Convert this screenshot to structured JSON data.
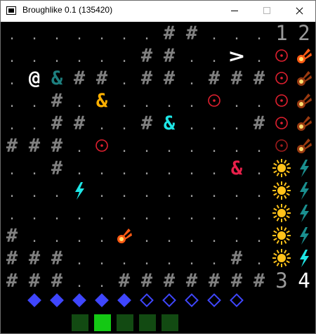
{
  "window": {
    "title": "Broughlike 0.1 (135420)",
    "icon": "console-window-icon",
    "controls": [
      "minimize-icon",
      "maximize-icon",
      "close-icon"
    ]
  },
  "colors": {
    "background": "#000000",
    "floor": "#9a9a9a",
    "wall": "#808080",
    "player": "#ffffff",
    "companion_teal": "#1d7f7f",
    "monster_orange": "#ffb000",
    "monster_cyan": "#1ee6e6",
    "monster_red": "#e8204a",
    "ring_red": "#e0202f",
    "ring_dark": "#a01c1c",
    "sun": "#ffc21a",
    "bolt_cyan": "#1ee6e6",
    "bolt_dark": "#1a8f8f",
    "meteor_orange": "#ff5a14",
    "meteor_dark": "#9a3a10",
    "mana_blue": "#3f46ff",
    "square_dark": "#124a12",
    "square_bright": "#14c814"
  },
  "glyphs": {
    "floor": ".",
    "wall": "#",
    "player": "@",
    "monster": "&",
    "exit": ">"
  },
  "map": {
    "rows": [
      ". . . . . . . ##. . . ",
      ". . . . . . ##. . > . ",
      ". @&##. ##. ###. ",
      ". . ##. &. . . . ○. . ",
      ". . ##. . #&. . . #. ",
      "###. ○. . . . . . . . ",
      ". . #. . . . . . . &. ",
      ". . . ϟ. . . . . . . . ",
      ". . . . . . . . . . . . ",
      "#. . . . ☄. . . . . . ",
      "###. . . . . . . #. . ",
      "###. . ###########"
    ]
  },
  "hud": {
    "stats": {
      "top_left": "1",
      "top_right": "2",
      "bottom_left": "3",
      "bottom_right": "4"
    },
    "mana": {
      "filled": 5,
      "total": 10
    },
    "squares": {
      "count": 5,
      "selected": 1
    }
  }
}
